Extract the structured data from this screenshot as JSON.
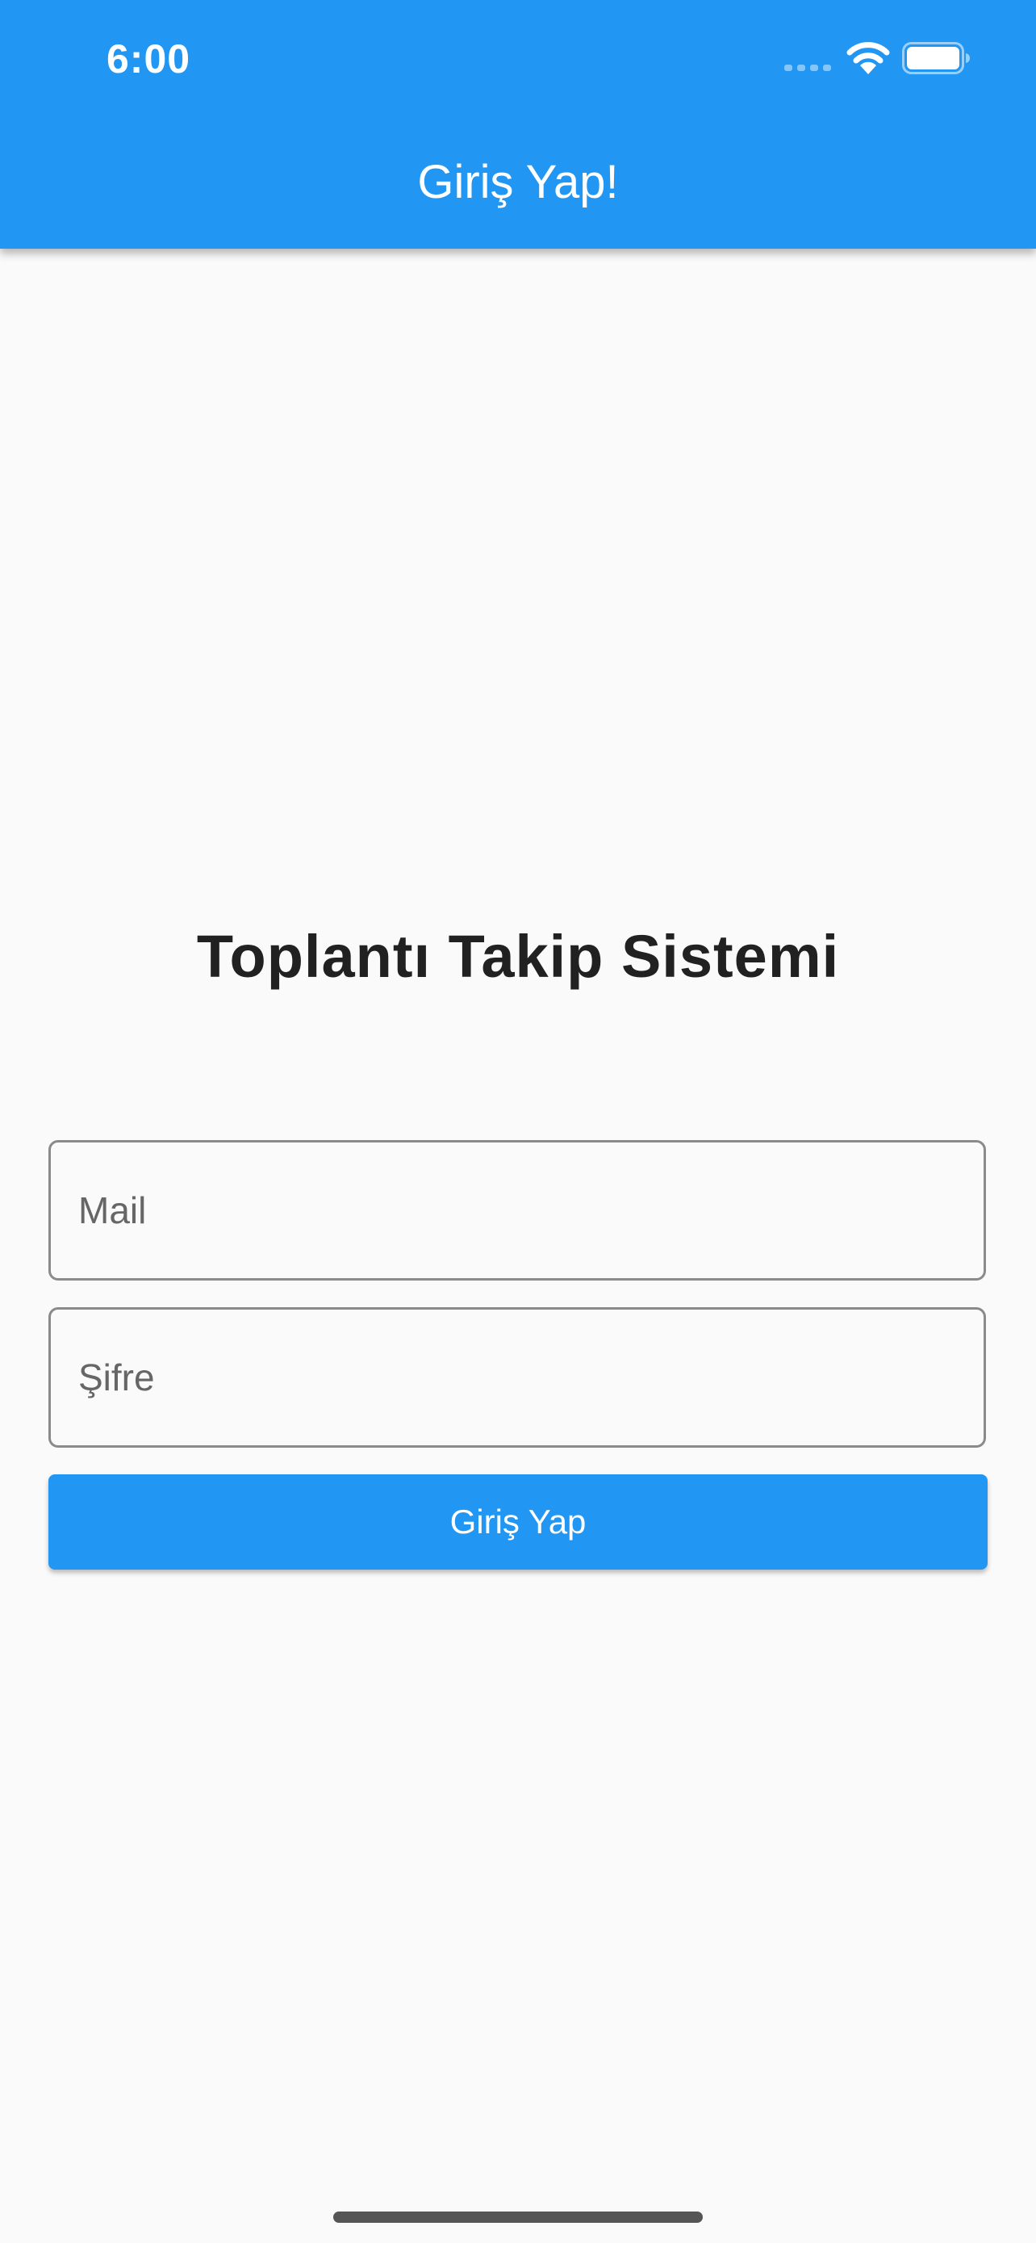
{
  "status_bar": {
    "time": "6:00"
  },
  "app_bar": {
    "title": "Giriş Yap!"
  },
  "main": {
    "heading": "Toplantı Takip Sistemi",
    "email_field": {
      "placeholder": "Mail",
      "value": ""
    },
    "password_field": {
      "placeholder": "Şifre",
      "value": ""
    },
    "login_button_label": "Giriş Yap"
  },
  "icons": {
    "signal": "cellular-signal-icon",
    "wifi": "wifi-icon",
    "battery": "battery-icon"
  },
  "colors": {
    "primary": "#2196f3",
    "background": "#fafafa",
    "text": "#212121",
    "border": "#8a8a8a"
  }
}
